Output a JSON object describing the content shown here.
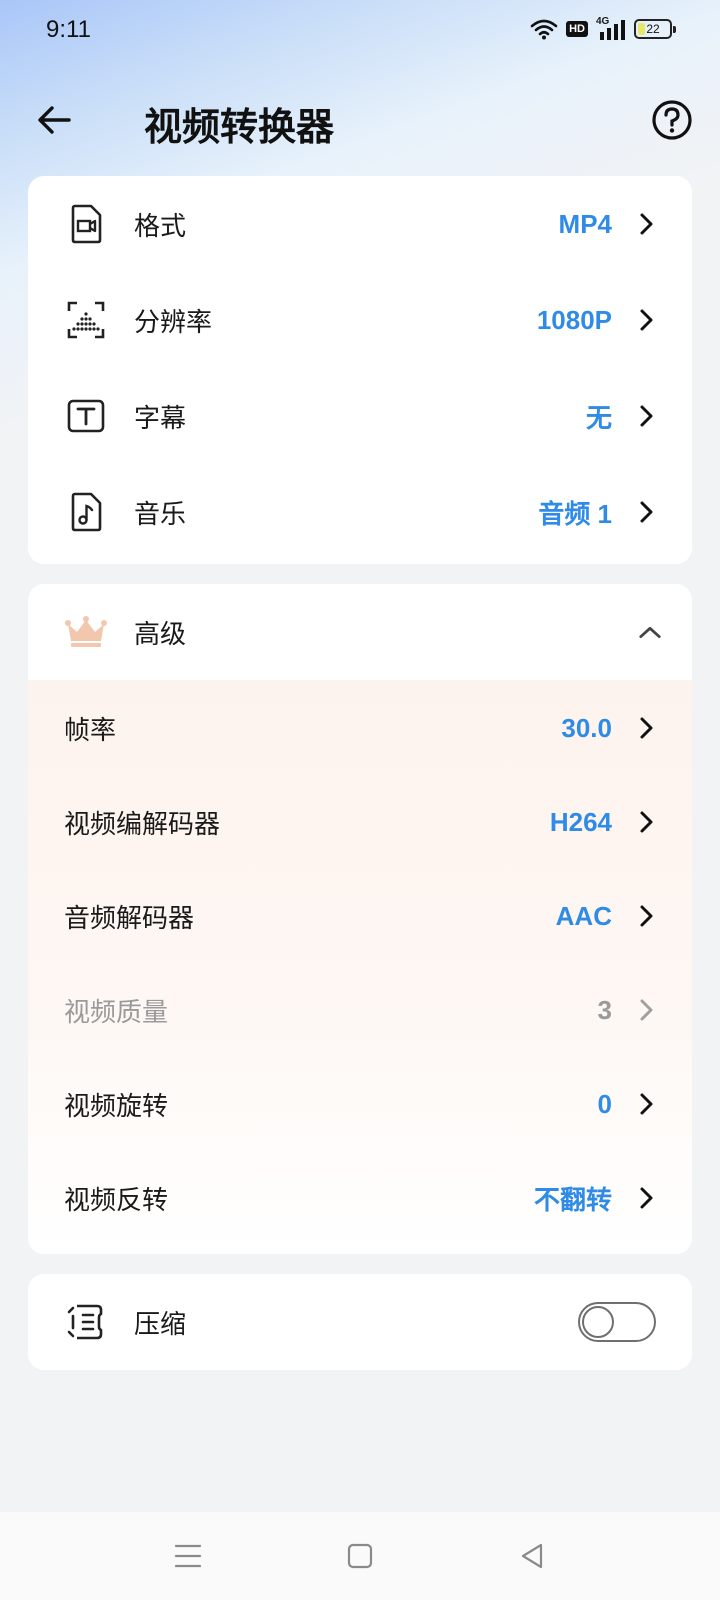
{
  "status_bar": {
    "time": "9:11",
    "hd": "HD",
    "network": "4G",
    "battery": "22",
    "battery_level": 0.22
  },
  "header": {
    "title": "视频转换器",
    "back_icon": "arrow-left-icon",
    "help_icon": "question-circle-icon"
  },
  "basic_settings": [
    {
      "label": "格式",
      "value": "MP4",
      "icon": "video-file-icon"
    },
    {
      "label": "分辨率",
      "value": "1080P",
      "icon": "resolution-icon"
    },
    {
      "label": "字幕",
      "value": "无",
      "icon": "text-box-icon"
    },
    {
      "label": "音乐",
      "value": "音频 1",
      "icon": "music-file-icon"
    }
  ],
  "advanced": {
    "title": "高级",
    "icon": "crown-icon",
    "expanded": true,
    "items": [
      {
        "label": "帧率",
        "value": "30.0",
        "enabled": true
      },
      {
        "label": "视频编解码器",
        "value": "H264",
        "enabled": true
      },
      {
        "label": "音频解码器",
        "value": "AAC",
        "enabled": true
      },
      {
        "label": "视频质量",
        "value": "3",
        "enabled": false
      },
      {
        "label": "视频旋转",
        "value": "0",
        "enabled": true
      },
      {
        "label": "视频反转",
        "value": "不翻转",
        "enabled": true
      }
    ]
  },
  "compress": {
    "label": "压缩",
    "icon": "compress-icon",
    "enabled": false
  },
  "colors": {
    "accent": "#2f8be6",
    "disabled": "#9a9a9a",
    "crown": "#f2c7ae"
  }
}
